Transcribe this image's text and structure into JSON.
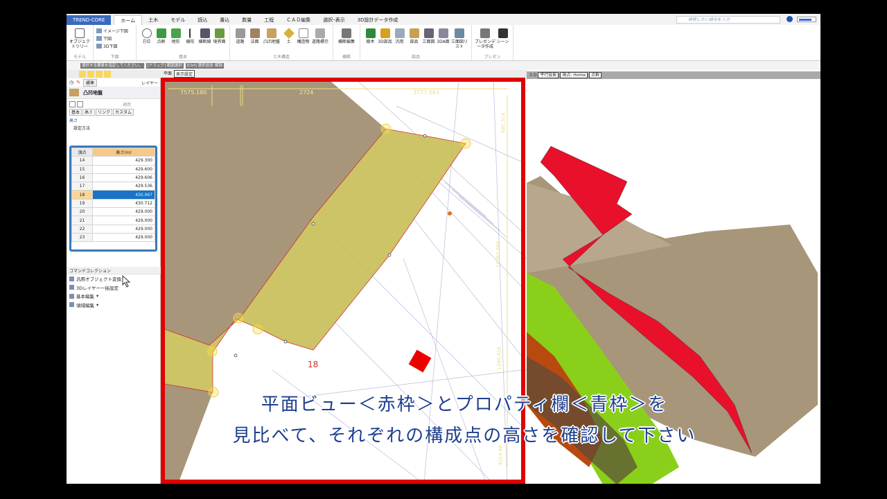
{
  "app": {
    "brand": "TREND-CORE",
    "tabs": [
      "ホーム",
      "土木",
      "モデル",
      "読込",
      "書込",
      "数量",
      "工程",
      "ＣＡＤ編集",
      "選択･表示",
      "3D設計データ作成"
    ],
    "active_tab": "ホーム",
    "search_placeholder": "検索したい語句を入力"
  },
  "ribbon": {
    "groups": [
      {
        "label": "モデル",
        "buttons": [
          "オブジェクトツリー"
        ]
      },
      {
        "label": "下図",
        "small": [
          "イメージ下図",
          "下図",
          "3D下図"
        ]
      },
      {
        "label": "基本",
        "buttons": [
          "方位",
          "点群",
          "地形",
          "線形",
          "横断線",
          "境界面"
        ]
      },
      {
        "label": "土木構造",
        "buttons": [
          "道路",
          "法面",
          "凸凹地盤",
          "土",
          "構造物",
          "道路標示"
        ]
      },
      {
        "label": "横断",
        "buttons": [
          "横断編集"
        ]
      },
      {
        "label": "部品",
        "buttons": [
          "樹木",
          "3D部品",
          "汎用",
          "部品",
          "三面図",
          "3DA面",
          "三面図リスト"
        ]
      },
      {
        "label": "プレゼン",
        "buttons": [
          "プレゼンデータ作成",
          "シーン"
        ]
      }
    ]
  },
  "status": {
    "hints": [
      "選択する要素を指定してください。",
      "[ドラッグ] 範囲選択",
      "[Ctrl] 選択追加･解除"
    ]
  },
  "left_panel": {
    "style_select": "標準",
    "layer_label": "レイヤー",
    "object_title": "凸凹地盤",
    "apply_label": "適用",
    "tabs": [
      "基本",
      "高さ",
      "リンク",
      "カスタム"
    ],
    "active_tab": "高さ",
    "section": "高さ",
    "setting_label": "設定方法",
    "table": {
      "headers": [
        "頂点",
        "高さ(m)"
      ],
      "rows": [
        [
          "14",
          "429.300"
        ],
        [
          "15",
          "429.600"
        ],
        [
          "16",
          "429.606"
        ],
        [
          "17",
          "429.536"
        ],
        [
          "18",
          "430.967"
        ],
        [
          "19",
          "430.712"
        ],
        [
          "20",
          "429.000"
        ],
        [
          "21",
          "429.000"
        ],
        [
          "22",
          "429.000"
        ],
        [
          "23",
          "429.000"
        ]
      ],
      "selected": "18"
    },
    "command_collection": {
      "title": "コマンドコレクション",
      "items": [
        "汎用オブジェクト変換",
        "3Dレイヤー一括設定",
        "基本編集",
        "領域編集"
      ]
    }
  },
  "plan_view": {
    "tab_labels": [
      "平面",
      "表示設定"
    ],
    "dimensions": [
      "7575.180",
      "2724",
      "3777.563",
      "681.516",
      "10363.594",
      "1340.428",
      "4224.98"
    ],
    "point_labels": [
      "18"
    ],
    "frame_color": "#e00000"
  },
  "view3d": {
    "label": "3 D",
    "tabs": [
      "平行投影",
      "視点: Home",
      "点群"
    ]
  },
  "subtitle": [
    "平面ビュー＜赤枠＞とプロパティ欄＜青枠＞を",
    "見比べて、それぞれの構成点の高さを確認して下さい"
  ]
}
